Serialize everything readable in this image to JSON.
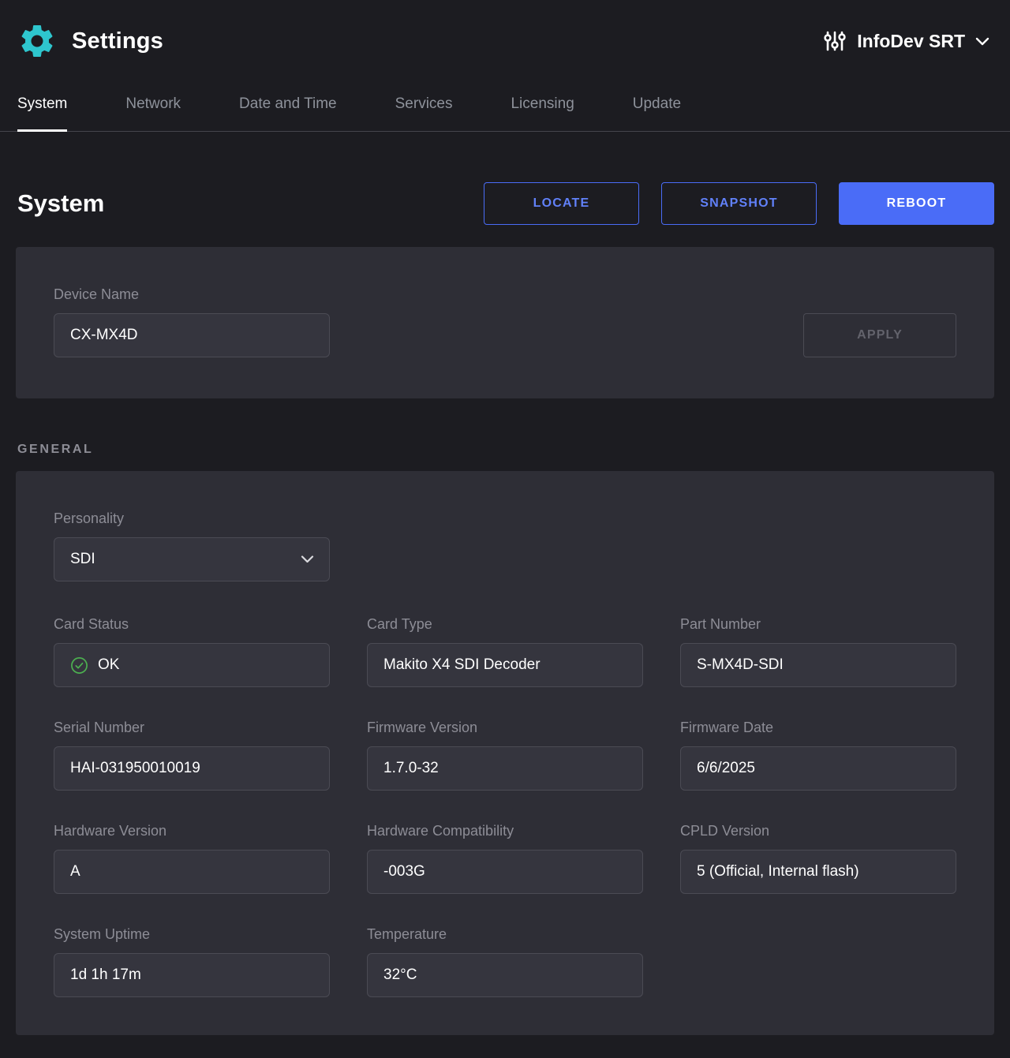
{
  "colors": {
    "accent_blue": "#4a6cf7",
    "brand_teal": "#2ec6ce",
    "status_green": "#4caf50",
    "page_background": "#1c1c21",
    "card_background": "#2e2e36"
  },
  "header": {
    "title": "Settings",
    "device_selector_label": "InfoDev SRT"
  },
  "icons": {
    "app_logo": "gear-icon",
    "device_selector": "sliders-icon",
    "device_selector_caret": "chevron-down-icon",
    "personality_caret": "chevron-down-icon",
    "card_status_ok": "check-circle-icon"
  },
  "tabs": [
    {
      "label": "System",
      "active": true
    },
    {
      "label": "Network",
      "active": false
    },
    {
      "label": "Date and Time",
      "active": false
    },
    {
      "label": "Services",
      "active": false
    },
    {
      "label": "Licensing",
      "active": false
    },
    {
      "label": "Update",
      "active": false
    }
  ],
  "page": {
    "title": "System",
    "actions": {
      "locate": "LOCATE",
      "snapshot": "SNAPSHOT",
      "reboot": "REBOOT"
    }
  },
  "device_name": {
    "label": "Device Name",
    "value": "CX-MX4D",
    "apply_label": "APPLY",
    "apply_enabled": false
  },
  "general": {
    "section_label": "GENERAL",
    "personality": {
      "label": "Personality",
      "value": "SDI"
    },
    "fields": [
      {
        "label": "Card Status",
        "value": "OK",
        "status": "ok"
      },
      {
        "label": "Card Type",
        "value": "Makito X4 SDI Decoder"
      },
      {
        "label": "Part Number",
        "value": "S-MX4D-SDI"
      },
      {
        "label": "Serial Number",
        "value": "HAI-031950010019"
      },
      {
        "label": "Firmware Version",
        "value": "1.7.0-32"
      },
      {
        "label": "Firmware Date",
        "value": "6/6/2025"
      },
      {
        "label": "Hardware Version",
        "value": "A"
      },
      {
        "label": "Hardware Compatibility",
        "value": "-003G"
      },
      {
        "label": "CPLD Version",
        "value": "5 (Official, Internal flash)"
      },
      {
        "label": "System Uptime",
        "value": "1d 1h 17m"
      },
      {
        "label": "Temperature",
        "value": "32°C"
      }
    ]
  }
}
